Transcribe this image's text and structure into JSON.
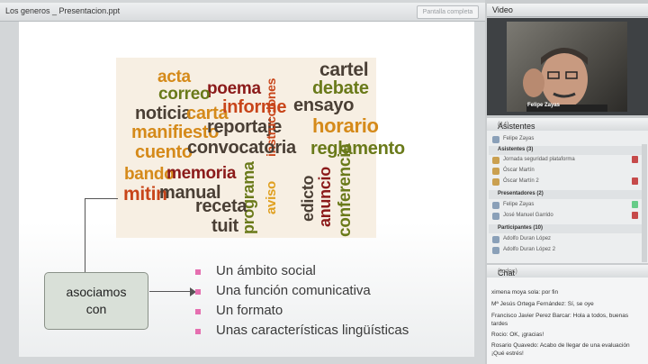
{
  "presentation": {
    "title": "Los generos _ Presentacion.ppt",
    "fullscreen_label": "Pantalla completa",
    "words": [
      {
        "text": "acta",
        "color": "#d58a1a"
      },
      {
        "text": "cartel",
        "color": "#4a3f35"
      },
      {
        "text": "poema",
        "color": "#8b1a1a"
      },
      {
        "text": "correo",
        "color": "#6a7a1a"
      },
      {
        "text": "debate",
        "color": "#6a7a1a"
      },
      {
        "text": "noticia",
        "color": "#4a3f35"
      },
      {
        "text": "carta",
        "color": "#d58a1a"
      },
      {
        "text": "informe",
        "color": "#c8451a"
      },
      {
        "text": "ensayo",
        "color": "#4a3f35"
      },
      {
        "text": "manifiesto",
        "color": "#d58a1a"
      },
      {
        "text": "reportaje",
        "color": "#4a3f35"
      },
      {
        "text": "horario",
        "color": "#d58a1a"
      },
      {
        "text": "instrucciones",
        "color": "#c8451a"
      },
      {
        "text": "cuento",
        "color": "#d58a1a"
      },
      {
        "text": "convocatoria",
        "color": "#4a3f35"
      },
      {
        "text": "reglamento",
        "color": "#6a7a1a"
      },
      {
        "text": "bando",
        "color": "#d58a1a"
      },
      {
        "text": "memoria",
        "color": "#8b1a1a"
      },
      {
        "text": "programa",
        "color": "#6a7a1a"
      },
      {
        "text": "aviso",
        "color": "#e0a020"
      },
      {
        "text": "edicto",
        "color": "#4a3f35"
      },
      {
        "text": "anuncio",
        "color": "#8b1a1a"
      },
      {
        "text": "conferencia",
        "color": "#6a7a1a"
      },
      {
        "text": "mitin",
        "color": "#c8451a"
      },
      {
        "text": "manual",
        "color": "#4a3f35"
      },
      {
        "text": "receta",
        "color": "#4a3f35"
      },
      {
        "text": "tuit",
        "color": "#4a3f35"
      }
    ],
    "callout": [
      "asociamos",
      "con"
    ],
    "bullets": [
      "Un ámbito social",
      "Una función comunicativa",
      "Un formato",
      "Unas características lingüísticas"
    ]
  },
  "video": {
    "header": "Video",
    "camera_name": "Felipe Zayas"
  },
  "attendees": {
    "header": "Asistentes",
    "count": "(14)",
    "me": "Felipe Zayas",
    "sections": [
      {
        "label": "Asistentes (3)",
        "rows": [
          "Jornada seguridad plataforma",
          "Óscar Martín",
          "Óscar Martín 2"
        ]
      },
      {
        "label": "Presentadores (2)",
        "rows": [
          "Felipe Zayas",
          "José Manuel Garrido"
        ]
      },
      {
        "label": "Participantes (10)",
        "rows": [
          "Adolfo Duran López",
          "Adolfo Duran López 2"
        ]
      }
    ]
  },
  "chat": {
    "header": "Chat",
    "scope": "(todos)",
    "messages": [
      "ximena moya sola: por fin",
      "Mª Jesús Ortega Fernández: Sí, se oye",
      "Francisco Javier Perez Barcar: Hola a todos, buenas tardes",
      "Rocio: OK, ¡gracias!",
      "Rosario Quavedo: Acabo de llegar de una evaluación ¡Qué estrés!"
    ]
  }
}
